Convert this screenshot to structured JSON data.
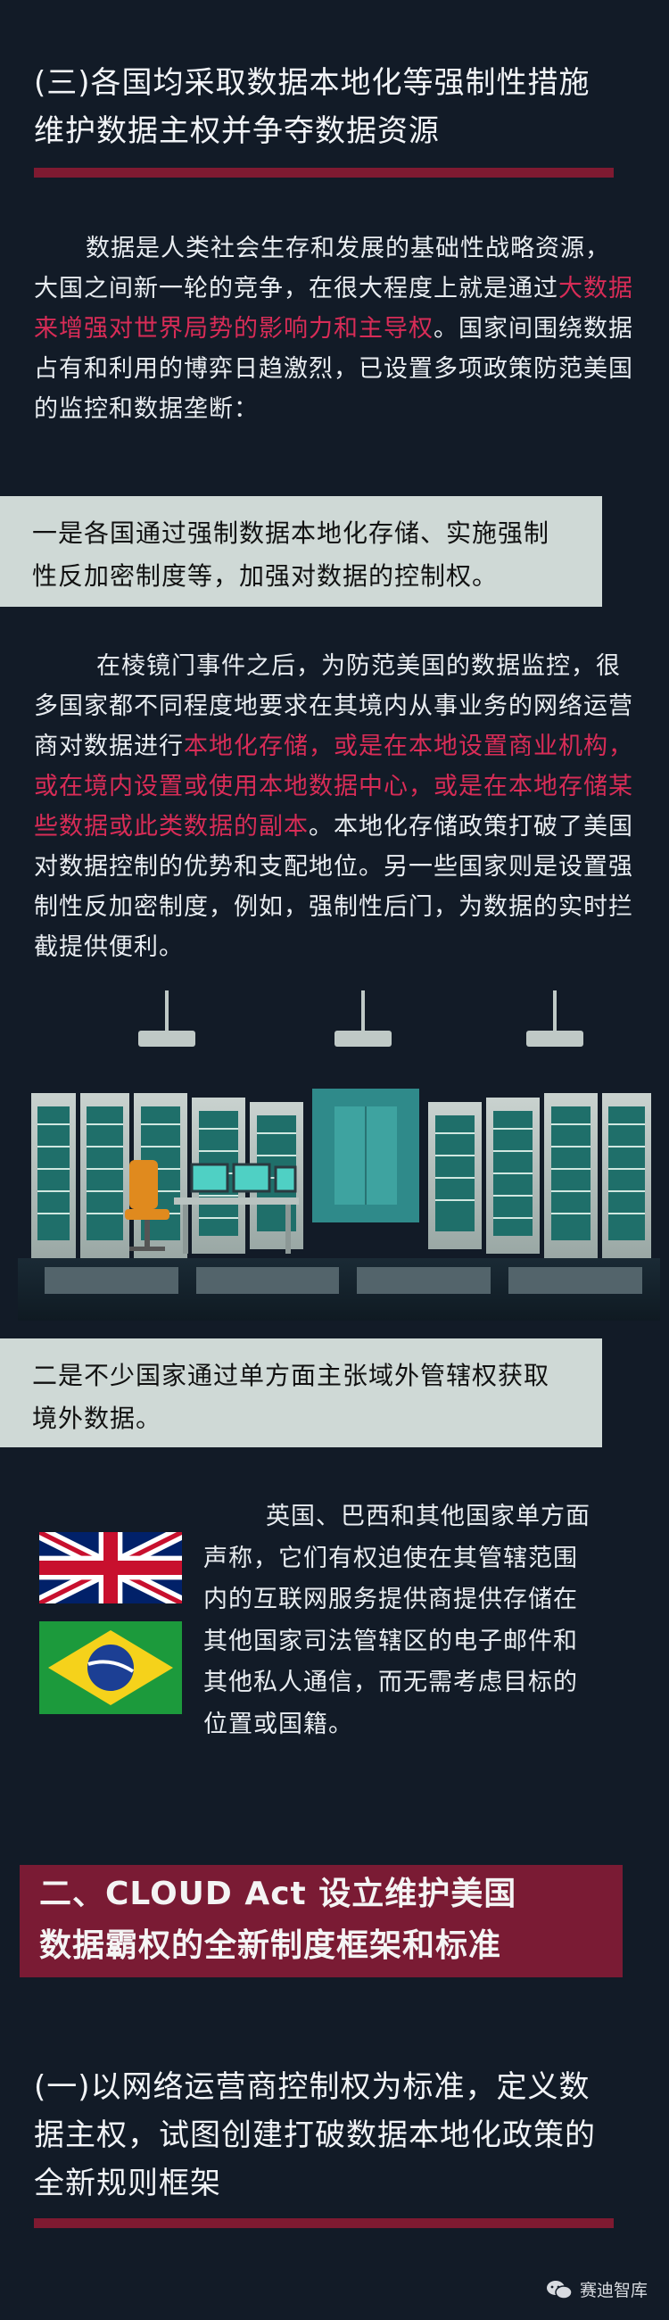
{
  "heading1": {
    "line1": "(三)各国均采取数据本地化等强制性措施",
    "line2": "维护数据主权并争夺数据资源"
  },
  "para1": {
    "part1": "数据是人类社会生存和发展的基础性战略资源，大国之间新一轮的竞争，在很大程度上就是通过",
    "highlight": "大数据来增强对世界局势的影响力和主导权",
    "part2": "。国家间围绕数据占有和利用的博弈日趋激烈，已设置多项政策防范美国的监控和数据垄断："
  },
  "callout1": {
    "line1": "一是各国通过强制数据本地化存储、实施强制",
    "line2": "性反加密制度等，加强对数据的控制权。"
  },
  "para2": {
    "part1": "在棱镜门事件之后，为防范美国的数据监控，很多国家都不同程度地要求在其境内从事业务的网络运营商对数据进行",
    "highlight": "本地化存储，或是在本地设置商业机构，或在境内设置或使用本地数据中心，或是在本地存储某些数据或此类数据的副本",
    "part2": "。本地化存储政策打破了美国对数据控制的优势和支配地位。另一些国家则是设置强制性反加密制度，例如，强制性后门，为数据的实时拦截提供便利。"
  },
  "callout2": {
    "line1": "二是不少国家通过单方面主张域外管辖权获取",
    "line2": "境外数据。"
  },
  "para3": {
    "lines": [
      "英国、巴西和其他国家单方面",
      "声称，它们有权迫使在其管辖范围",
      "内的互联网服务提供商提供存储在",
      "其他国家司法管辖区的电子邮件和",
      "其他私人通信，而无需考虑目标的",
      "位置或国籍。"
    ]
  },
  "section2": {
    "line1": "二、CLOUD Act 设立维护美国",
    "line2": "数据霸权的全新制度框架和标准"
  },
  "heading2": {
    "line1": "(一)以网络运营商控制权为标准，定义数",
    "line2": "据主权，试图创建打破数据本地化政策的",
    "line3": "全新规则框架"
  },
  "brand": {
    "name": "赛迪智库"
  },
  "colors": {
    "background": "#121b27",
    "accent_red": "#d82c57",
    "bar_red": "#7f1a31",
    "callout_bg": "#cfd9d6",
    "section_bg": "#7a1b34"
  },
  "icons": {
    "flag_uk": "uk-flag-icon",
    "flag_brazil": "brazil-flag-icon",
    "brand": "wechat-brand-icon",
    "illustration": "server-room-illustration"
  }
}
